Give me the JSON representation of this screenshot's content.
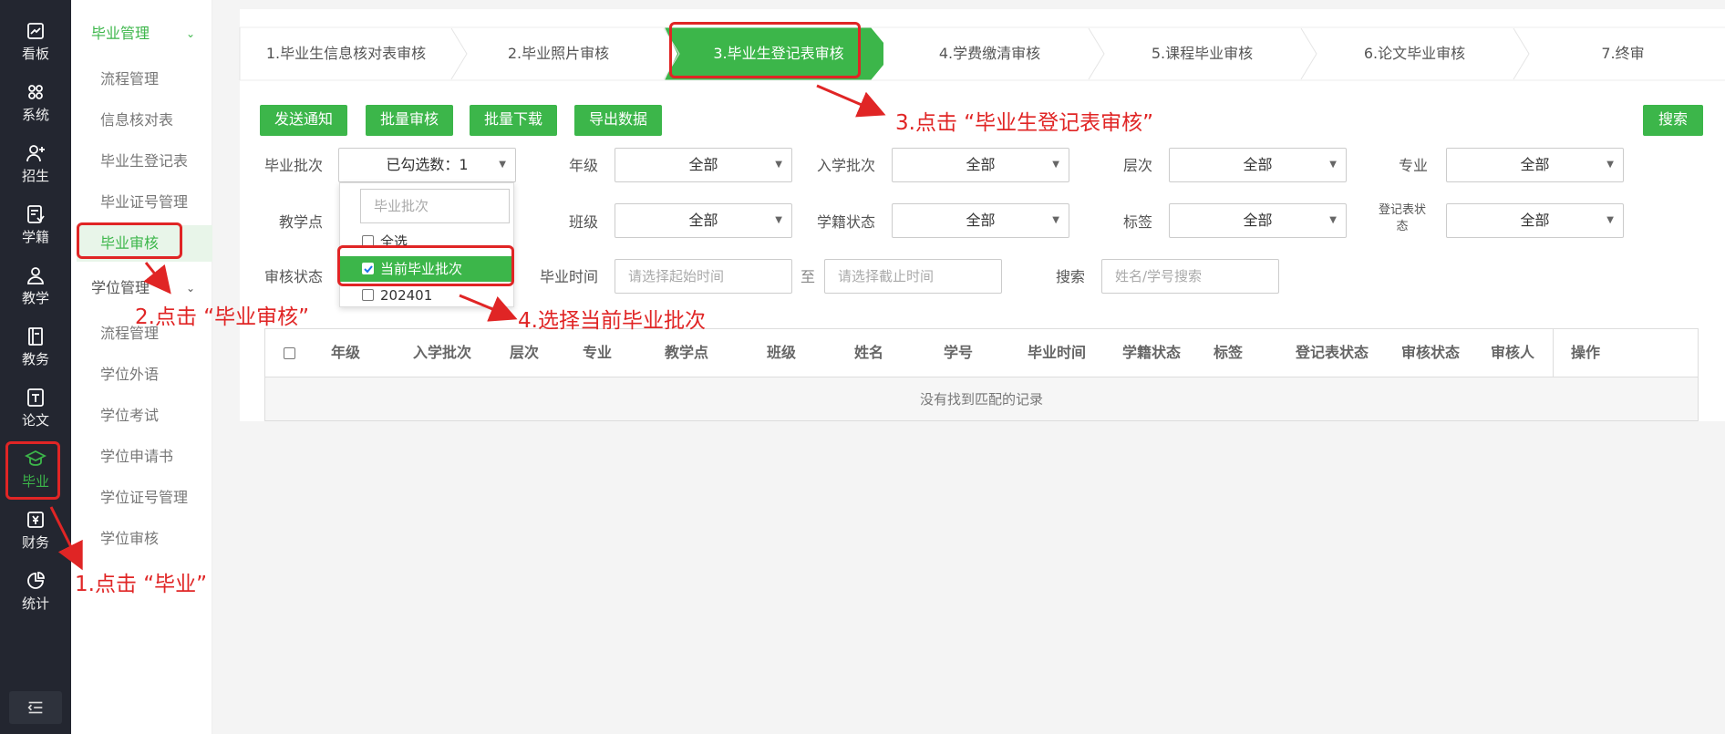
{
  "rail": {
    "items": [
      {
        "label": "看板",
        "icon": "dashboard-chart-icon"
      },
      {
        "label": "系统",
        "icon": "grid-apps-icon"
      },
      {
        "label": "招生",
        "icon": "user-add-icon"
      },
      {
        "label": "学籍",
        "icon": "student-record-icon"
      },
      {
        "label": "教学",
        "icon": "teacher-icon"
      },
      {
        "label": "教务",
        "icon": "book-icon"
      },
      {
        "label": "论文",
        "icon": "document-icon"
      },
      {
        "label": "毕业",
        "icon": "graduation-cap-icon"
      },
      {
        "label": "财务",
        "icon": "finance-yen-icon"
      },
      {
        "label": "统计",
        "icon": "pie-chart-icon"
      }
    ],
    "active_label": "毕业",
    "toggle_icon": "menu-collapse-icon"
  },
  "submenu": {
    "group1": {
      "title": "毕业管理",
      "items": [
        "流程管理",
        "信息核对表",
        "毕业生登记表",
        "毕业证号管理",
        "毕业审核"
      ]
    },
    "group2": {
      "title": "学位管理",
      "items": [
        "流程管理",
        "学位外语",
        "学位考试",
        "学位申请书",
        "学位证号管理",
        "学位审核"
      ]
    },
    "active_item": "毕业审核"
  },
  "steps": [
    "1.毕业生信息核对表审核",
    "2.毕业照片审核",
    "3.毕业生登记表审核",
    "4.学费缴清审核",
    "5.课程毕业审核",
    "6.论文毕业审核",
    "7.终审"
  ],
  "active_step": "3.毕业生登记表审核",
  "buttons": {
    "notify": "发送通知",
    "batch_review": "批量审核",
    "batch_download": "批量下载",
    "export": "导出数据",
    "search": "搜索"
  },
  "filters": {
    "batch": {
      "label": "毕业批次",
      "value": "已勾选数：1"
    },
    "grade": {
      "label": "年级",
      "value": "全部"
    },
    "intake": {
      "label": "入学批次",
      "value": "全部"
    },
    "level": {
      "label": "层次",
      "value": "全部"
    },
    "major": {
      "label": "专业",
      "value": "全部"
    },
    "site": {
      "label": "教学点"
    },
    "class": {
      "label": "班级",
      "value": "全部"
    },
    "status": {
      "label": "学籍状态",
      "value": "全部"
    },
    "tag": {
      "label": "标签",
      "value": "全部"
    },
    "reg_status": {
      "label": "登记表状态",
      "value": "全部"
    },
    "review_status": {
      "label": "审核状态"
    },
    "grad_time": {
      "label": "毕业时间",
      "start_placeholder": "请选择起始时间",
      "sep": "至",
      "end_placeholder": "请选择截止时间"
    },
    "search": {
      "label": "搜索",
      "placeholder": "姓名/学号搜索"
    }
  },
  "dropdown": {
    "search_placeholder": "毕业批次",
    "options": [
      {
        "label": "全选",
        "checked": false
      },
      {
        "label": "当前毕业批次",
        "checked": true
      },
      {
        "label": "202401",
        "checked": false
      }
    ]
  },
  "table": {
    "headers": [
      "年级",
      "入学批次",
      "层次",
      "专业",
      "教学点",
      "班级",
      "姓名",
      "学号",
      "毕业时间",
      "学籍状态",
      "标签",
      "登记表状态",
      "审核状态",
      "审核人",
      "操作"
    ],
    "empty_text": "没有找到匹配的记录"
  },
  "annotations": {
    "step1": "1.点击 “毕业”",
    "step2": "2.点击 “毕业审核”",
    "step3": "3.点击 “毕业生登记表审核”",
    "step4": "4.选择当前毕业批次"
  },
  "colors": {
    "accent": "#3cb64a",
    "annotation": "#e02525",
    "sidebar_bg": "#232630"
  }
}
